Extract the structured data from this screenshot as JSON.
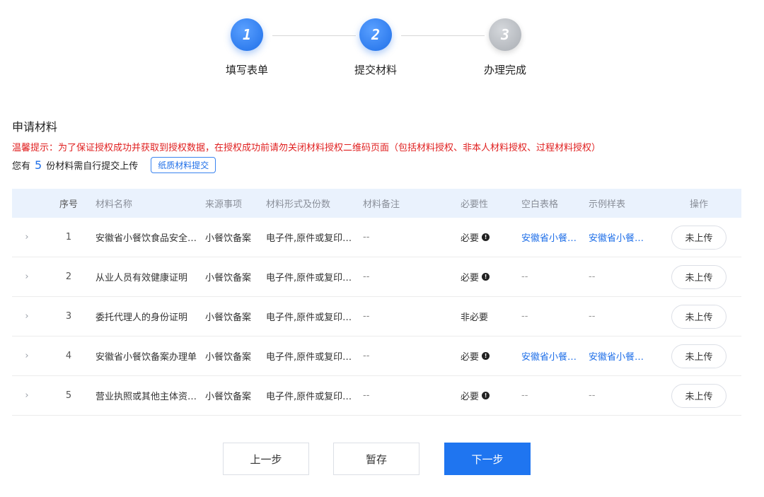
{
  "steps": [
    {
      "num": "1",
      "label": "填写表单",
      "state": "active"
    },
    {
      "num": "2",
      "label": "提交材料",
      "state": "active"
    },
    {
      "num": "3",
      "label": "办理完成",
      "state": "pending"
    }
  ],
  "section": {
    "title": "申请材料",
    "tip": "温馨提示：为了保证授权成功并获取到授权数据，在授权成功前请勿关闭材料授权二维码页面（包括材料授权、非本人材料授权、过程材料授权）",
    "count_prefix": "您有",
    "count": "5",
    "count_suffix": "份材料需自行提交上传",
    "paper_button": "纸质材料提交"
  },
  "table": {
    "headers": {
      "index": "序号",
      "name": "材料名称",
      "source": "来源事项",
      "form": "材料形式及份数",
      "note": "材料备注",
      "necessity": "必要性",
      "blank": "空白表格",
      "sample": "示例样表",
      "action": "操作"
    },
    "rows": [
      {
        "expand": "›",
        "index": "1",
        "name": "安徽省小餐饮食品安全…",
        "source": "小餐饮备案",
        "form": "电子件,原件或复印…",
        "note": "--",
        "necessity": "必要",
        "info": "!",
        "blank": "安徽省小餐…",
        "sample": "安徽省小餐…",
        "action": "未上传"
      },
      {
        "expand": "›",
        "index": "2",
        "name": "从业人员有效健康证明",
        "source": "小餐饮备案",
        "form": "电子件,原件或复印…",
        "note": "--",
        "necessity": "必要",
        "info": "!",
        "blank": "--",
        "sample": "--",
        "action": "未上传"
      },
      {
        "expand": "›",
        "index": "3",
        "name": "委托代理人的身份证明",
        "source": "小餐饮备案",
        "form": "电子件,原件或复印…",
        "note": "--",
        "necessity": "非必要",
        "info": "",
        "blank": "--",
        "sample": "--",
        "action": "未上传"
      },
      {
        "expand": "›",
        "index": "4",
        "name": "安徽省小餐饮备案办理单",
        "source": "小餐饮备案",
        "form": "电子件,原件或复印…",
        "note": "--",
        "necessity": "必要",
        "info": "!",
        "blank": "安徽省小餐…",
        "sample": "安徽省小餐…",
        "action": "未上传"
      },
      {
        "expand": "›",
        "index": "5",
        "name": "营业执照或其他主体资…",
        "source": "小餐饮备案",
        "form": "电子件,原件或复印…",
        "note": "--",
        "necessity": "必要",
        "info": "!",
        "blank": "--",
        "sample": "--",
        "action": "未上传"
      }
    ]
  },
  "buttons": {
    "prev": "上一步",
    "save": "暂存",
    "next": "下一步"
  },
  "colors": {
    "primary": "#1f75f0",
    "warning_text": "#e02020",
    "header_bg": "#eaf2fd"
  }
}
